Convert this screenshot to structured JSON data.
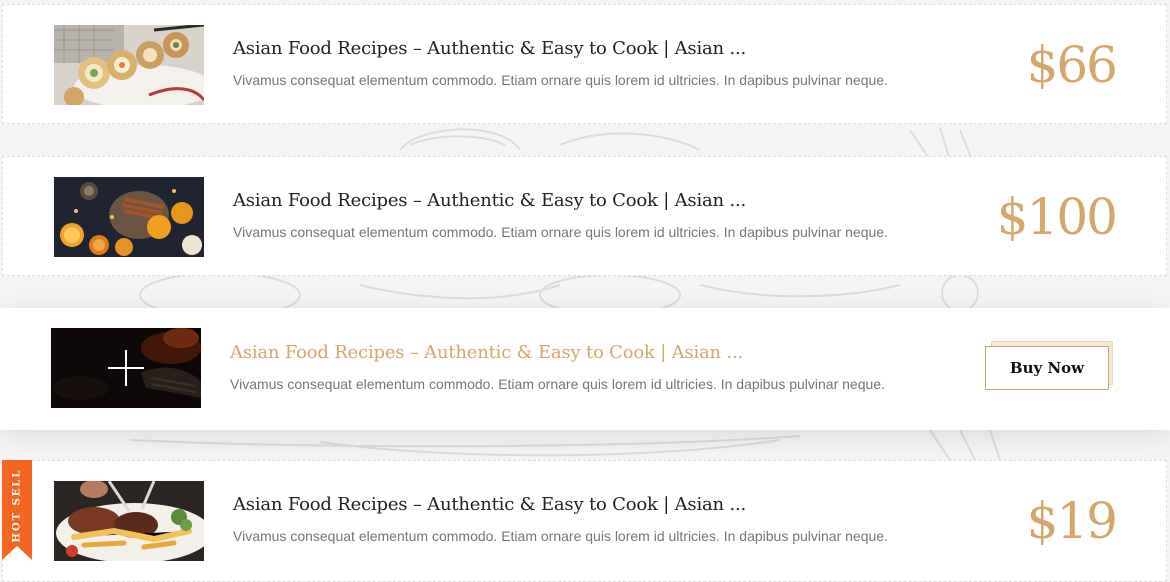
{
  "menu": {
    "items": [
      {
        "title": "Asian Food Recipes – Authentic & Easy to Cook | Asian ...",
        "description": "Vivamus consequat elementum commodo. Etiam ornare quis lorem id ultricies. In dapibus pulvinar neque.",
        "price": "$66",
        "image": "sushi-rolls-photo"
      },
      {
        "title": "Asian Food Recipes – Authentic & Easy to Cook | Asian ...",
        "description": "Vivamus consequat elementum commodo. Etiam ornare quis lorem id ultricies. In dapibus pulvinar neque.",
        "price": "$100",
        "image": "spices-citrus-photo"
      },
      {
        "title": "Asian Food Recipes – Authentic & Easy to Cook | Asian ...",
        "description": "Vivamus consequat elementum commodo. Etiam ornare quis lorem id ultricies. In dapibus pulvinar neque.",
        "button_label": "Buy Now",
        "image": "grilled-dish-photo",
        "state": "hovered"
      },
      {
        "title": "Asian Food Recipes – Authentic & Easy to Cook | Asian ...",
        "description": "Vivamus consequat elementum commodo. Etiam ornare quis lorem id ultricies. In dapibus pulvinar neque.",
        "price": "$19",
        "image": "steak-plate-photo",
        "badge": "HOT SELL"
      }
    ]
  },
  "colors": {
    "accent": "#d4a76a",
    "badge": "#f26522",
    "title": "#222222",
    "description": "#777777"
  },
  "icons": {
    "overlay": "plus-icon"
  }
}
